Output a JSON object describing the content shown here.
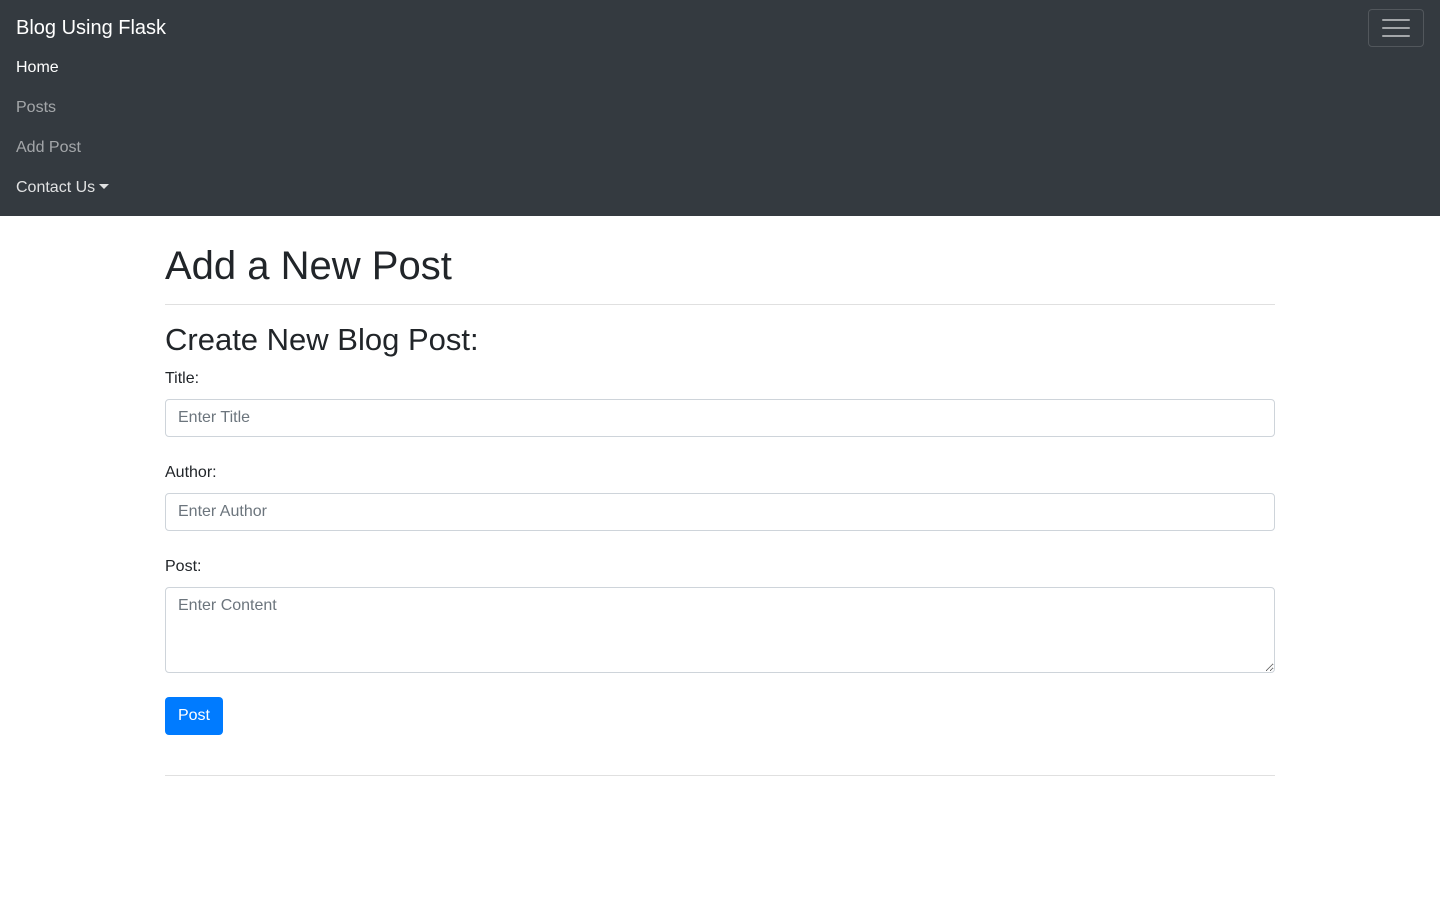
{
  "navbar": {
    "brand": "Blog Using Flask",
    "toggler_icon": "hamburger-menu-icon",
    "links": {
      "home": "Home",
      "posts": "Posts",
      "add_post": "Add Post",
      "contact": "Contact Us"
    },
    "dropdown_icon": "caret-down-icon"
  },
  "page": {
    "title": "Add a New Post",
    "form_title": "Create New Blog Post:"
  },
  "form": {
    "title_label": "Title:",
    "title_placeholder": "Enter Title",
    "author_label": "Author:",
    "author_placeholder": "Enter Author",
    "post_label": "Post:",
    "post_placeholder": "Enter Content",
    "submit_label": "Post"
  },
  "colors": {
    "navbar_bg": "#343a40",
    "primary": "#007bff"
  }
}
